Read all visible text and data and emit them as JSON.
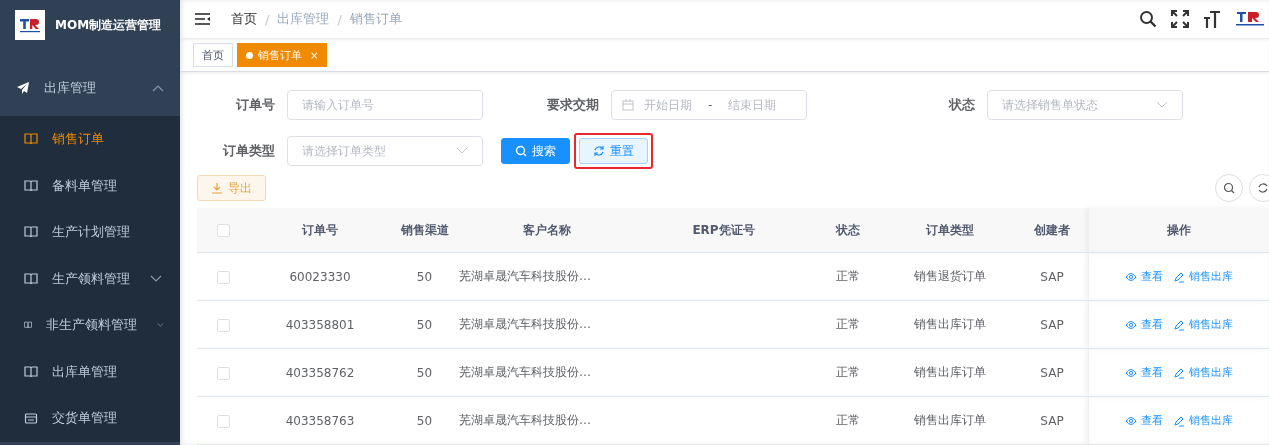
{
  "app": {
    "title": "MOM制造运营管理"
  },
  "sidebar": {
    "items": [
      {
        "label": "出库管理",
        "expanded": true,
        "children": [
          {
            "label": "销售订单",
            "kind": "book",
            "selected": true,
            "has_children": false
          },
          {
            "label": "备料单管理",
            "kind": "book",
            "selected": false,
            "has_children": false
          },
          {
            "label": "生产计划管理",
            "kind": "book",
            "selected": false,
            "has_children": false
          },
          {
            "label": "生产领料管理",
            "kind": "book",
            "selected": false,
            "has_children": true
          },
          {
            "label": "非生产领料管理",
            "kind": "book",
            "selected": false,
            "has_children": true
          },
          {
            "label": "出库单管理",
            "kind": "book",
            "selected": false,
            "has_children": false
          },
          {
            "label": "交货单管理",
            "kind": "calendar",
            "selected": false,
            "has_children": false
          }
        ]
      }
    ]
  },
  "breadcrumb": [
    "首页",
    "出库管理",
    "销售订单"
  ],
  "breadcrumb_separator": "/",
  "tabs": [
    {
      "label": "首页",
      "selected": false,
      "closable": false
    },
    {
      "label": "销售订单",
      "selected": true,
      "closable": true
    }
  ],
  "close_glyph": "×",
  "filters": {
    "order_no": {
      "label": "订单号",
      "placeholder": "请输入订单号"
    },
    "due_date": {
      "label": "要求交期",
      "start_placeholder": "开始日期",
      "separator": "-",
      "end_placeholder": "结束日期"
    },
    "status": {
      "label": "状态",
      "placeholder": "请选择销售单状态"
    },
    "order_type": {
      "label": "订单类型",
      "placeholder": "请选择订单类型"
    },
    "search_button": "搜索",
    "reset_button": {
      "label": "重置",
      "highlighted": true
    }
  },
  "export_button": "导出",
  "table": {
    "all_checked": false,
    "columns": [
      "订单号",
      "销售渠道",
      "客户名称",
      "ERP凭证号",
      "状态",
      "订单类型",
      "创建者",
      "操作"
    ],
    "rows": [
      {
        "checked": false,
        "order_no": "60023330",
        "channel": "50",
        "customer": "芜湖卓晟汽车科技股份…",
        "status": "正常",
        "type": "销售退货订单",
        "creator": "SAP",
        "actions": [
          "查看",
          "销售出库"
        ]
      },
      {
        "checked": false,
        "order_no": "403358801",
        "channel": "50",
        "customer": "芜湖卓晟汽车科技股份…",
        "status": "正常",
        "type": "销售出库订单",
        "creator": "SAP",
        "actions": [
          "查看",
          "销售出库"
        ]
      },
      {
        "checked": false,
        "order_no": "403358762",
        "channel": "50",
        "customer": "芜湖卓晟汽车科技股份…",
        "status": "正常",
        "type": "销售出库订单",
        "creator": "SAP",
        "actions": [
          "查看",
          "销售出库"
        ]
      },
      {
        "checked": false,
        "order_no": "403358763",
        "channel": "50",
        "customer": "芜湖卓晟汽车科技股份…",
        "status": "正常",
        "type": "销售出库订单",
        "creator": "SAP",
        "actions": [
          "查看",
          "销售出库"
        ]
      }
    ]
  }
}
